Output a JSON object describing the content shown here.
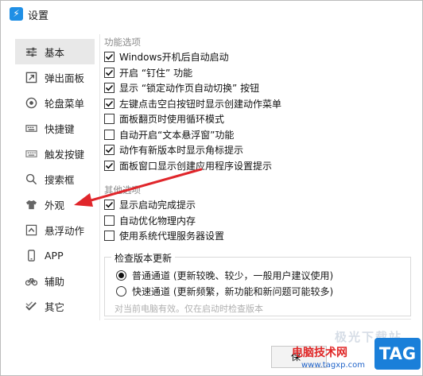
{
  "window": {
    "title": "设置",
    "icon": "lightning-icon",
    "accent": "#1f8fe5"
  },
  "sidebar": {
    "items": [
      {
        "label": "基本",
        "icon": "sliders-icon",
        "selected": true
      },
      {
        "label": "弹出面板",
        "icon": "popup-panel-icon",
        "selected": false
      },
      {
        "label": "轮盘菜单",
        "icon": "wheel-menu-icon",
        "selected": false
      },
      {
        "label": "快捷键",
        "icon": "keyboard-icon",
        "selected": false
      },
      {
        "label": "触发按键",
        "icon": "trigger-key-icon",
        "selected": false
      },
      {
        "label": "搜索框",
        "icon": "search-icon",
        "selected": false
      },
      {
        "label": "外观",
        "icon": "tshirt-icon",
        "selected": false
      },
      {
        "label": "悬浮动作",
        "icon": "float-action-icon",
        "selected": false
      },
      {
        "label": "APP",
        "icon": "phone-icon",
        "selected": false
      },
      {
        "label": "辅助",
        "icon": "bicycle-icon",
        "selected": false
      },
      {
        "label": "其它",
        "icon": "double-check-icon",
        "selected": false
      }
    ]
  },
  "function_options": {
    "title": "功能选项",
    "items": [
      {
        "label": "Windows开机后自动启动",
        "checked": true
      },
      {
        "label": "开启 “钉住” 功能",
        "checked": true
      },
      {
        "label": "显示 “锁定动作页自动切换” 按钮",
        "checked": true
      },
      {
        "label": "左键点击空白按钮时显示创建动作菜单",
        "checked": true
      },
      {
        "label": "面板翻页时使用循环模式",
        "checked": false
      },
      {
        "label": "自动开启“文本悬浮窗”功能",
        "checked": false
      },
      {
        "label": "动作有新版本时显示角标提示",
        "checked": true
      },
      {
        "label": "面板窗口显示创建应用程序设置提示",
        "checked": true
      }
    ]
  },
  "other_options": {
    "title": "其他选项",
    "items": [
      {
        "label": "显示启动完成提示",
        "checked": true
      },
      {
        "label": "自动优化物理内存",
        "checked": false
      },
      {
        "label": "使用系统代理服务器设置",
        "checked": false
      }
    ]
  },
  "update_check": {
    "title": "检查版本更新",
    "options": [
      {
        "label": "普通通道 (更新较晚、较少，一般用户建议使用)",
        "selected": true
      },
      {
        "label": "快速通道 (更新频繁，新功能和新问题可能较多)",
        "selected": false
      }
    ],
    "note": "对当前电脑有效。仅在启动时检查版本"
  },
  "footer": {
    "save_label": "保"
  },
  "annotation": {
    "arrow_color": "#e0262b",
    "arrow_target": "外观"
  },
  "watermark": {
    "faded_text": "极光下载站",
    "site_name": "电脑技术网",
    "url": "www.tagxp.com",
    "badge": "TAG",
    "badge_color": "#1a7fd9"
  }
}
